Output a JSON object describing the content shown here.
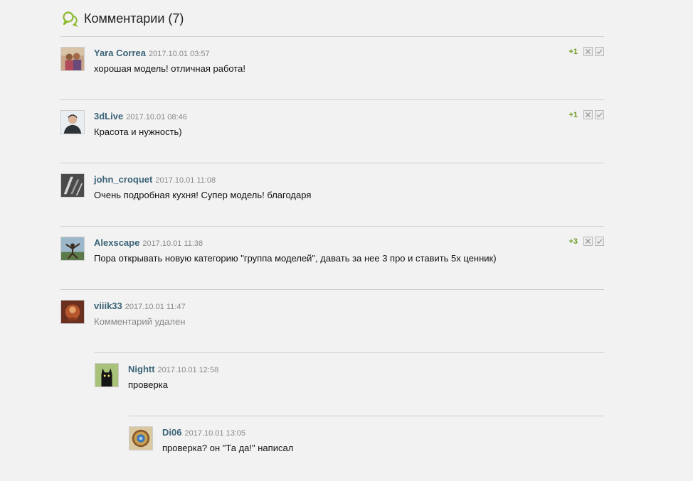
{
  "header": {
    "title": "Комментарии (7)",
    "icon": "speech-bubbles-icon"
  },
  "colors": {
    "accent": "#8bb82d",
    "author": "#3b6477",
    "score": "#6a9a1f"
  },
  "comments": [
    {
      "author": "Yara Correa",
      "date": "2017.10.01 03:57",
      "text": "хорошая модель! отличная работа!",
      "score": "+1"
    },
    {
      "author": "3dLive",
      "date": "2017.10.01 08:46",
      "text": "Красота и нужность)",
      "score": "+1"
    },
    {
      "author": "john_croquet",
      "date": "2017.10.01 11:08",
      "text": "Очень подробная кухня! Супер модель! благодаря"
    },
    {
      "author": "Alexscape",
      "date": "2017.10.01 11:38",
      "text": "Пора открывать новую категорию \"группа моделей\", давать за нее 3 про и ставить 5х ценник)",
      "score": "+3"
    },
    {
      "author": "viiik33",
      "date": "2017.10.01 11:47",
      "text": "Комментарий удален"
    },
    {
      "author": "Nightt",
      "date": "2017.10.01 12:58",
      "text": "проверка"
    },
    {
      "author": "Di06",
      "date": "2017.10.01 13:05",
      "text": "проверка? он \"Та да!\" написал"
    }
  ]
}
